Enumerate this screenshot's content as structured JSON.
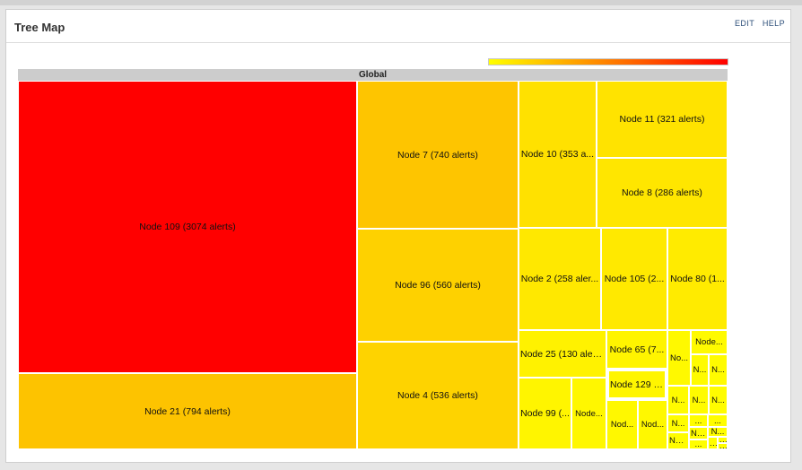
{
  "panel": {
    "title": "Tree Map",
    "edit_label": "EDIT",
    "help_label": "HELP"
  },
  "treemap": {
    "root_label": "Global",
    "legend": {
      "low_color": "#ffff00",
      "high_color": "#ff0000"
    },
    "nodes": [
      {
        "id": "n109",
        "label": "Node 109 (3074 alerts)",
        "color": "#ff0000"
      },
      {
        "id": "n21",
        "label": "Node 21 (794 alerts)",
        "color": "#fdc300"
      },
      {
        "id": "n7",
        "label": "Node 7 (740 alerts)",
        "color": "#fec500"
      },
      {
        "id": "n96",
        "label": "Node 96 (560 alerts)",
        "color": "#fed100"
      },
      {
        "id": "n4",
        "label": "Node 4 (536 alerts)",
        "color": "#fed300"
      },
      {
        "id": "n10",
        "label": "Node 10 (353 a...",
        "color": "#ffe100"
      },
      {
        "id": "n11",
        "label": "Node 11 (321 alerts)",
        "color": "#ffe300"
      },
      {
        "id": "n8",
        "label": "Node 8 (286 alerts)",
        "color": "#ffe600"
      },
      {
        "id": "n2",
        "label": "Node 2 (258 aler...",
        "color": "#ffe800"
      },
      {
        "id": "n105",
        "label": "Node 105 (2...",
        "color": "#ffe900"
      },
      {
        "id": "n80",
        "label": "Node 80 (1...",
        "color": "#ffeb00"
      },
      {
        "id": "n25",
        "label": "Node 25 (130 alerts)",
        "color": "#fff200"
      },
      {
        "id": "n65",
        "label": "Node 65 (7...",
        "color": "#fff400"
      },
      {
        "id": "n129",
        "label": "Node 129 (...",
        "color": "#fff500",
        "selected": true
      },
      {
        "id": "n99",
        "label": "Node 99 (...",
        "color": "#fff500"
      },
      {
        "id": "nA",
        "label": "Node...",
        "color": "#fff700"
      },
      {
        "id": "nB",
        "label": "Nod...",
        "color": "#fff800"
      },
      {
        "id": "nC",
        "label": "Nod...",
        "color": "#fff800"
      },
      {
        "id": "nD",
        "label": "No...",
        "color": "#fff900"
      },
      {
        "id": "nE",
        "label": "Node...",
        "color": "#fffa00"
      },
      {
        "id": "nF",
        "label": "N...",
        "color": "#fffb00"
      },
      {
        "id": "nG",
        "label": "N...",
        "color": "#fffb00"
      },
      {
        "id": "nH",
        "label": "N...",
        "color": "#fffb00"
      },
      {
        "id": "nI",
        "label": "N...",
        "color": "#fffb00"
      },
      {
        "id": "nJ",
        "label": "N...",
        "color": "#fffc00"
      },
      {
        "id": "nK",
        "label": "N...",
        "color": "#fffc00"
      },
      {
        "id": "nL",
        "label": "No...",
        "color": "#fffc00"
      },
      {
        "id": "nM",
        "label": "...",
        "color": "#fffd00"
      },
      {
        "id": "nN",
        "label": "...",
        "color": "#fffd00"
      },
      {
        "id": "nO",
        "label": "No...",
        "color": "#fffd00"
      },
      {
        "id": "nP",
        "label": "N...",
        "color": "#fffd00"
      },
      {
        "id": "nQ",
        "label": "...",
        "color": "#fffe00"
      },
      {
        "id": "nR",
        "label": "...",
        "color": "#fffe00"
      },
      {
        "id": "nS",
        "label": "...",
        "color": "#fffe00"
      },
      {
        "id": "nT",
        "label": "...",
        "color": "#fffe00"
      },
      {
        "id": "nU",
        "label": "...",
        "color": "#fffe00"
      }
    ]
  }
}
